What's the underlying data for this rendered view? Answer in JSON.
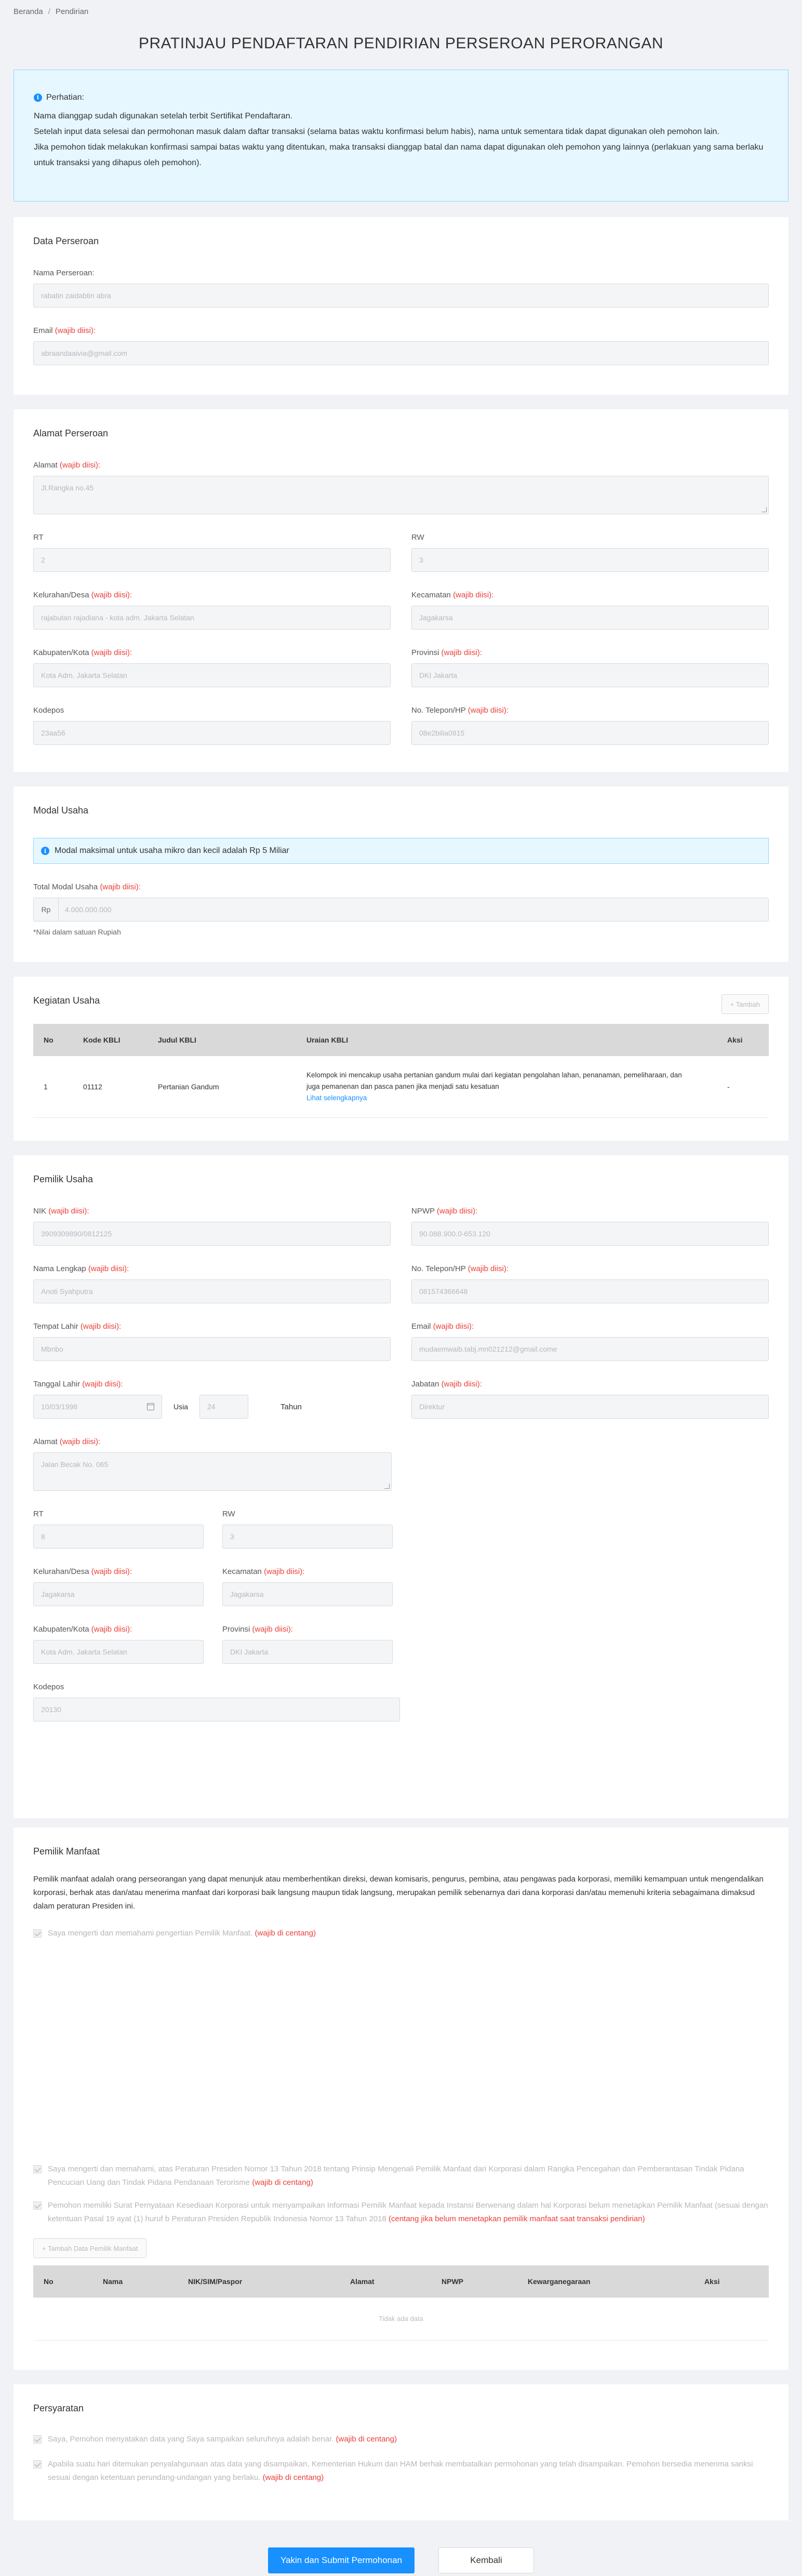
{
  "breadcrumb": [
    "Beranda",
    "Pendirian"
  ],
  "title": "PRATINJAU PENDAFTARAN PENDIRIAN PERSEROAN PERORANGAN",
  "notice": {
    "heading": "Perhatian:",
    "lines": [
      "Nama dianggap sudah digunakan setelah terbit Sertifikat Pendaftaran.",
      "Setelah input data selesai dan permohonan masuk dalam daftar transaksi (selama batas waktu konfirmasi belum habis), nama untuk sementara tidak dapat digunakan oleh pemohon lain.",
      "Jika pemohon tidak melakukan konfirmasi sampai batas waktu yang ditentukan, maka transaksi dianggap batal dan nama dapat digunakan oleh pemohon yang lainnya (perlakuan yang sama berlaku untuk transaksi yang dihapus oleh pemohon)."
    ]
  },
  "required": "(wajib diisi):",
  "data_perseroan": {
    "title": "Data Perseroan",
    "nama_label": "Nama Perseroan:",
    "nama_value": "rabatin zaidabtin abra",
    "email_label": "Email",
    "email_value": "abraandaaivia@gmail.com"
  },
  "alamat": {
    "title": "Alamat Perseroan",
    "alamat_label": "Alamat",
    "alamat_value": "Jl.Rangka no.45",
    "rt_label": "RT",
    "rt_value": "2",
    "rw_label": "RW",
    "rw_value": "3",
    "kel_label": "Kelurahan/Desa",
    "kel_value": "rajabutan rajadiana - kota adm. Jakarta Selatan",
    "kec_label": "Kecamatan",
    "kec_value": "Jagakarsa",
    "kab_label": "Kabupaten/Kota",
    "kab_value": "Kota Adm. Jakarta Selatan",
    "prov_label": "Provinsi",
    "prov_value": "DKI Jakarta",
    "pos_label": "Kodepos",
    "pos_value": "23aa56",
    "telp_label": "No. Telepon/HP",
    "telp_value": "08e2bilia0815"
  },
  "modal": {
    "title": "Modal Usaha",
    "info": "Modal maksimal untuk usaha mikro dan kecil adalah Rp 5 Miliar",
    "total_label": "Total Modal Usaha",
    "prefix": "Rp",
    "value": "4.000.000.000",
    "hint": "*Nilai dalam satuan Rupiah"
  },
  "kegiatan": {
    "title": "Kegiatan Usaha",
    "tambah": "+ Tambah",
    "headers": [
      "No",
      "Kode KBLI",
      "Judul KBLI",
      "Uraian KBLI",
      "Aksi"
    ],
    "rows": [
      {
        "no": "1",
        "kode": "01112",
        "judul": "Pertanian Gandum",
        "uraian": "Kelompok ini mencakup usaha pertanian gandum mulai dari kegiatan pengolahan lahan, penanaman, pemeliharaan, dan juga pemanenan dan pasca panen jika menjadi satu kesatuan",
        "link": "Lihat selengkapnya",
        "aksi": "-"
      }
    ]
  },
  "pemilik": {
    "title": "Pemilik Usaha",
    "nik_label": "NIK",
    "nik_value": "3909309890/0812125",
    "npwp_label": "NPWP",
    "npwp_value": "90.088.900.0-653.120",
    "nama_label": "Nama Lengkap",
    "nama_value": "Anoti Syahputra",
    "telp_label": "No. Telepon/HP",
    "telp_value": "081574366648",
    "tempat_label": "Tempat Lahir",
    "tempat_value": "Mbnbo",
    "email_label": "Email",
    "email_value": "mudaemwaib.tabj.mn021212@gmail.come",
    "tgl_label": "Tanggal Lahir",
    "tgl_value": "10/03/1998",
    "usia_label": "Usia",
    "usia_value": "24",
    "tahun_label": "Tahun",
    "jabatan_label": "Jabatan",
    "jabatan_value": "Direktur",
    "alamat_label": "Alamat",
    "alamat_value": "Jalan Becak No. 065",
    "rt_label": "RT",
    "rt_value": "8",
    "rw_label": "RW",
    "rw_value": "3",
    "kel_label": "Kelurahan/Desa",
    "kel_value": "Jagakarsa",
    "kec_label": "Kecamatan",
    "kec_value": "Jagakarsa",
    "kab_label": "Kabupaten/Kota",
    "kab_value": "Kota Adm. Jakarta Selatan",
    "prov_label": "Provinsi",
    "prov_value": "DKI Jakarta",
    "pos_label": "Kodepos",
    "pos_value": "20130"
  },
  "manfaat": {
    "title": "Pemilik Manfaat",
    "desc": "Pemilik manfaat adalah orang perseorangan yang dapat menunjuk atau memberhentikan direksi, dewan komisaris, pengurus, pembina, atau pengawas pada korporasi, memiliki kemampuan untuk mengendalikan korporasi, berhak atas dan/atau menerima manfaat dari korporasi baik langsung maupun tidak langsung, merupakan pemilik sebenarnya dari dana korporasi dan/atau memenuhi kriteria sebagaimana dimaksud dalam peraturan Presiden ini.",
    "check1": "Saya mengerti dan memahami pengertian Pemilik Manfaat.",
    "check1_req": "(wajib di centang)",
    "check2": "Saya mengerti dan memahami, atas Peraturan Presiden Nomor 13 Tahun 2018 tentang Prinsip Mengenali Pemilik Manfaat dari Korporasi dalam Rangka Pencegahan dan Pemberantasan Tindak Pidana Pencucian Uang dan Tindak Pidana Pendanaan Terorisme",
    "check2_req": "(wajib di centang)",
    "check3": "Pemohon memiliki Surat Pernyataan Kesediaan Korporasi untuk menyampaikan Informasi Pemilik Manfaat kepada Instansi Berwenang dalam hal Korporasi belum menetapkan Pemilik Manfaat (sesuai dengan ketentuan Pasal 19 ayat (1) huruf b Peraturan Presiden Republik Indonesia Nomor 13 Tahun 2018",
    "check3_req": "(centang jika belum menetapkan pemilik manfaat saat transaksi pendirian)",
    "tambah": "+ Tambah Data Pemilik Manfaat",
    "headers": [
      "No",
      "Nama",
      "NIK/SIM/Paspor",
      "Alamat",
      "NPWP",
      "Kewarganegaraan",
      "Aksi"
    ],
    "empty": "Tidak ada data"
  },
  "persyaratan": {
    "title": "Persyaratan",
    "check1": "Saya, Pemohon menyatakan data yang Saya sampaikan seluruhnya adalah benar.",
    "check1_req": "(wajib di centang)",
    "check2": "Apabila suatu hari ditemukan penyalahgunaan atas data yang disampaikan, Kementerian Hukum dan HAM berhak membatalkan permohonan yang telah disampaikan. Pemohon bersedia menerima sanksi sesuai dengan ketentuan perundang-undangan yang berlaku.",
    "check2_req": "(wajib di centang)"
  },
  "buttons": {
    "submit": "Yakin dan Submit Permohonan",
    "back": "Kembali"
  },
  "colors": {
    "accent": "#1890ff",
    "required": "#e8403a"
  }
}
